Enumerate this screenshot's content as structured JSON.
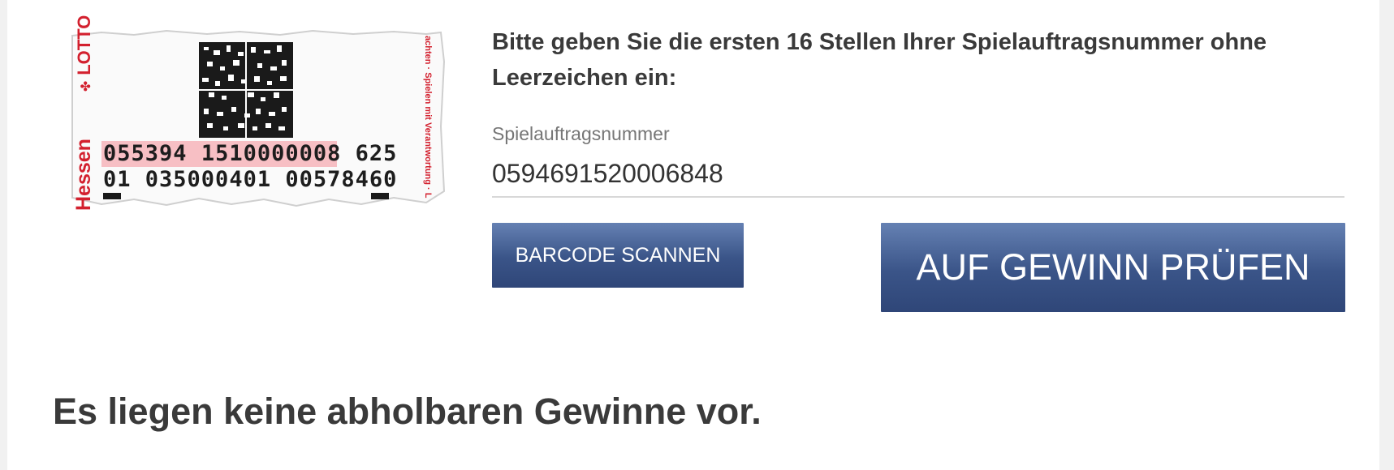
{
  "ticket": {
    "brand": "LOTTO",
    "region": "Hessen",
    "line1_a": "055394",
    "line1_b": "1510000008",
    "line1_c": "625",
    "line2_a": "01",
    "line2_b": "035000401",
    "line2_c": "00578460",
    "side_text": "achten · Spielen mit Verantwortung · L"
  },
  "form": {
    "instruction": "Bitte geben Sie die ersten 16 Stellen Ihrer Spielauftragsnummer ohne Leerzeichen ein:",
    "field_label": "Spielauftragsnummer",
    "field_value": "0594691520006848",
    "scan_button": "BARCODE SCANNEN",
    "check_button": "AUF GEWINN PRÜFEN"
  },
  "result": {
    "message": "Es liegen keine abholbaren Gewinne vor."
  },
  "colors": {
    "button_top": "#6581b3",
    "button_bottom": "#2f4678",
    "ticket_red": "#d3202e",
    "highlight_pink": "#f7bfc4"
  }
}
